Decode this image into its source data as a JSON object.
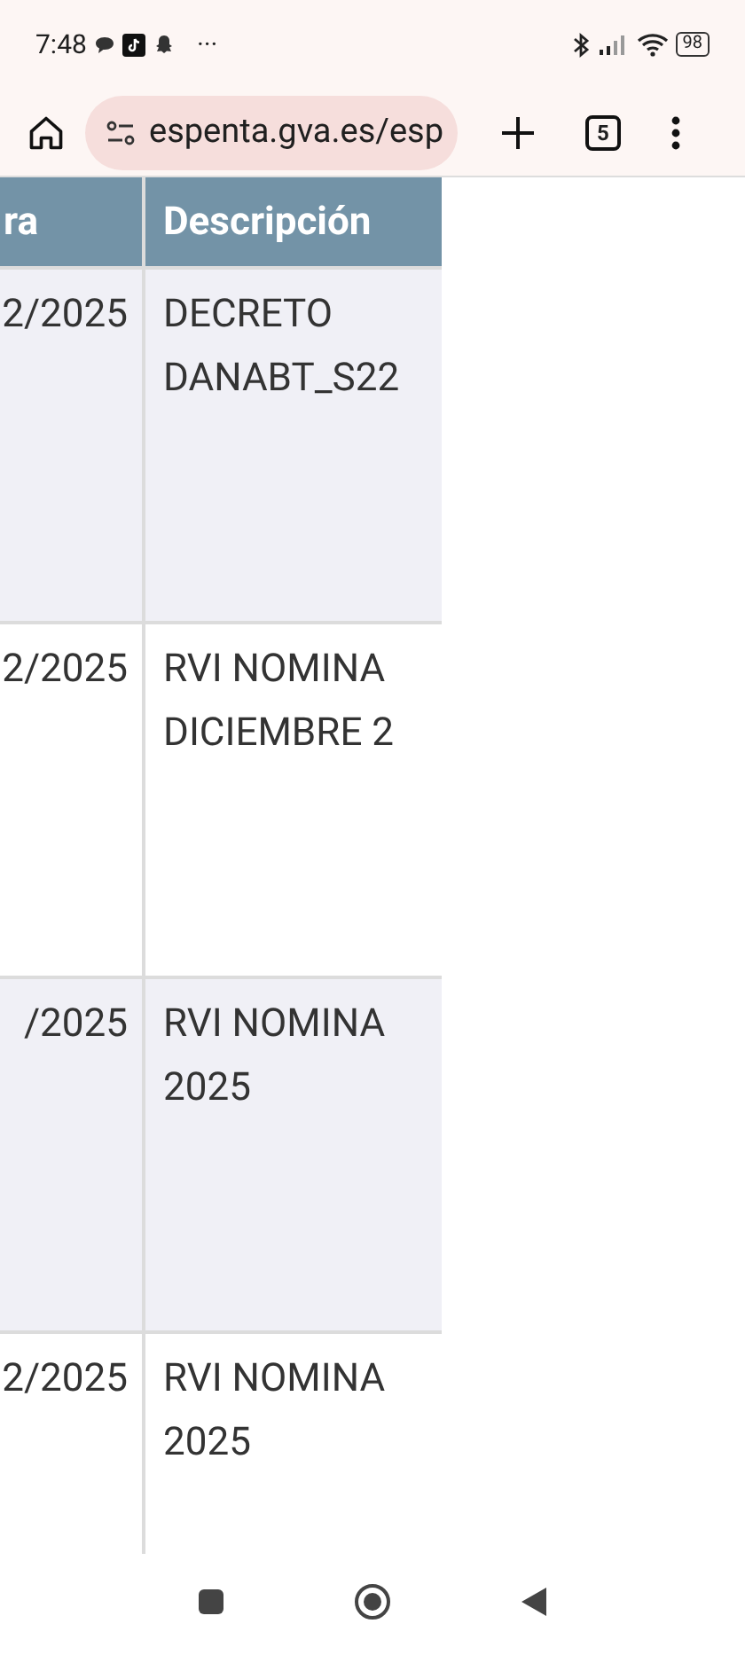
{
  "status_bar": {
    "time": "7:48",
    "more": "···",
    "battery": "98"
  },
  "browser": {
    "url": "espenta.gva.es/esp",
    "tab_count": "5"
  },
  "table": {
    "columns": [
      "ra",
      "Descripción"
    ],
    "rows": [
      {
        "column_1": "2/2025",
        "description": [
          "DECRETO",
          "DANABT_S22"
        ]
      },
      {
        "column_1": "2/2025",
        "description": [
          "RVI NOMINA",
          "DICIEMBRE 2"
        ]
      },
      {
        "column_1": "/2025",
        "description": [
          "RVI NOMINA",
          "2025"
        ]
      },
      {
        "column_1": "2/2025",
        "description": [
          "RVI NOMINA",
          "2025"
        ]
      }
    ]
  }
}
